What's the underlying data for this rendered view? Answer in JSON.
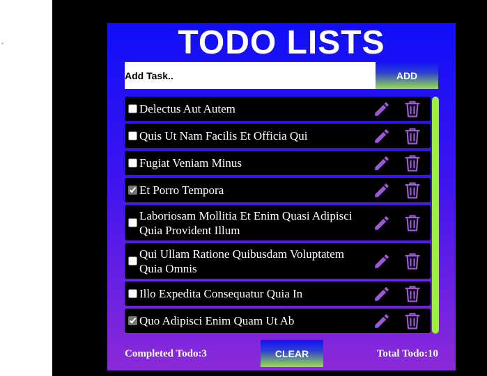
{
  "app": {
    "title": "TODO LISTS"
  },
  "add_task": {
    "placeholder": "Add Task..",
    "value": "",
    "button_label": "ADD"
  },
  "todos": [
    {
      "text": "Delectus Aut Autem",
      "checked": false
    },
    {
      "text": "Quis Ut Nam Facilis Et Officia Qui",
      "checked": false
    },
    {
      "text": "Fugiat Veniam Minus",
      "checked": false
    },
    {
      "text": "Et Porro Tempora",
      "checked": true
    },
    {
      "text": "Laboriosam Mollitia Et Enim Quasi Adipisci Quia Provident Illum",
      "checked": false
    },
    {
      "text": "Qui Ullam Ratione Quibusdam Voluptatem Quia Omnis",
      "checked": false
    },
    {
      "text": "Illo Expedita Consequatur Quia In",
      "checked": false
    },
    {
      "text": "Quo Adipisci Enim Quam Ut Ab",
      "checked": true
    }
  ],
  "icons": {
    "edit": "pencil-icon",
    "delete": "trash-icon"
  },
  "footer": {
    "completed_label": "Completed Todo:3",
    "clear_label": "CLEAR",
    "total_label": "Total Todo:10"
  },
  "colors": {
    "background": "#000000",
    "card_top": "#0f0ff7",
    "card_bottom": "#8c2ad8",
    "icon": "#9b59d6",
    "scrollbar": "#9cf03c",
    "button_gradient_end": "#98e04a"
  }
}
